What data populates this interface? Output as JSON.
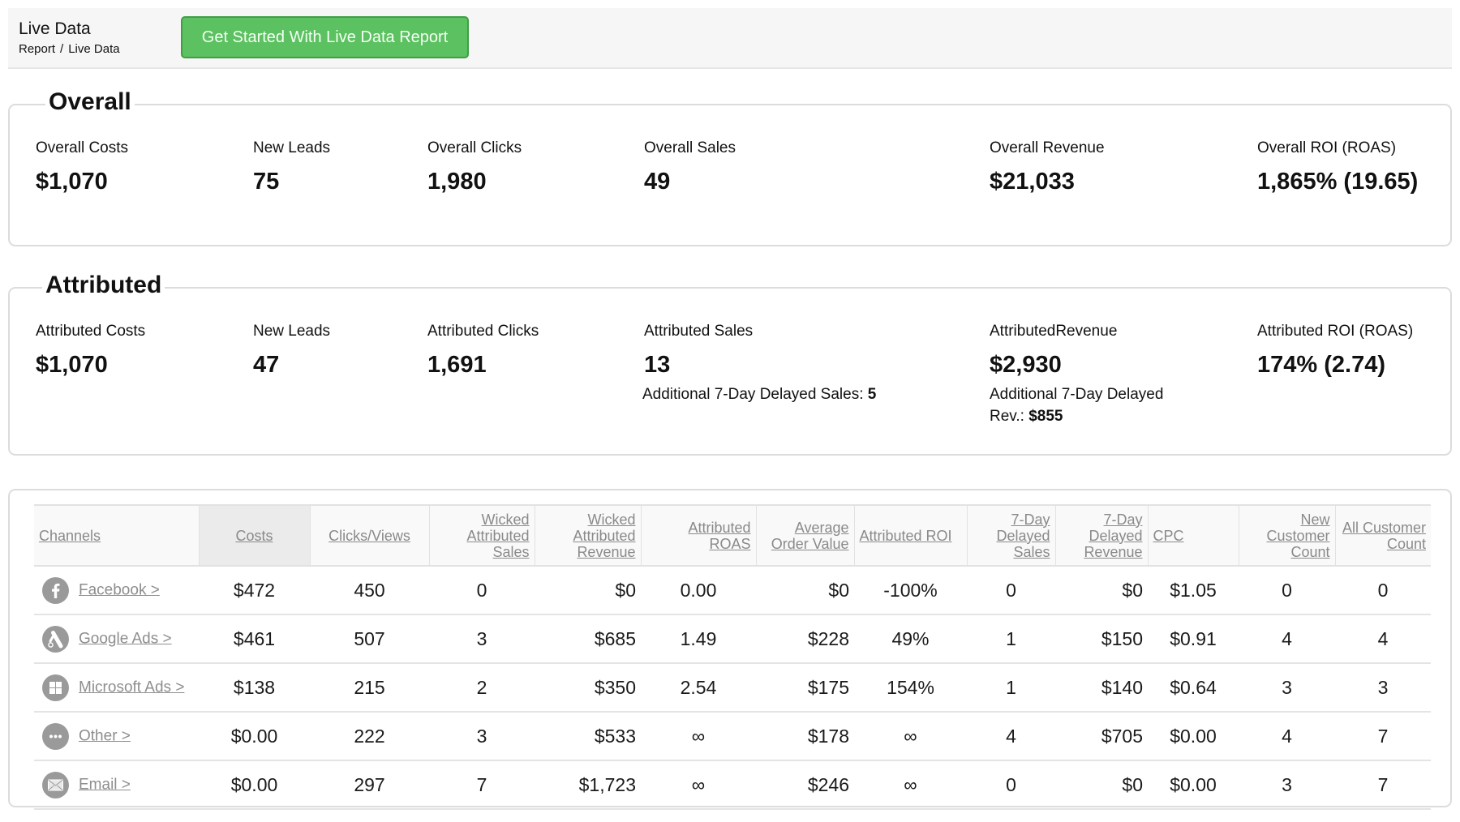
{
  "header": {
    "title": "Live Data",
    "breadcrumb": [
      "Report",
      "Live Data"
    ],
    "breadcrumb_separator": "/",
    "cta_label": "Get Started With Live Data Report",
    "cta_color": "#5cc160"
  },
  "overall": {
    "title": "Overall",
    "metrics": [
      {
        "label": "Overall Costs",
        "value": "$1,070"
      },
      {
        "label": "New Leads",
        "value": "75"
      },
      {
        "label": "Overall Clicks",
        "value": "1,980"
      },
      {
        "label": "Overall Sales",
        "value": "49"
      },
      {
        "label": "Overall Revenue",
        "value": "$21,033"
      },
      {
        "label": "Overall ROI (ROAS)",
        "value": "1,865% (19.65)"
      }
    ]
  },
  "attributed": {
    "title": "Attributed",
    "metrics": [
      {
        "label": "Attributed Costs",
        "value": "$1,070"
      },
      {
        "label": "New Leads",
        "value": "47"
      },
      {
        "label": "Attributed Clicks",
        "value": "1,691"
      },
      {
        "label": "Attributed Sales",
        "value": "13",
        "sub_label": "Additional 7-Day Delayed Sales: ",
        "sub_value": "5"
      },
      {
        "label": "AttributedRevenue",
        "value": "$2,930",
        "sub_label": "Additional 7-Day Delayed Rev.: ",
        "sub_value": "$855"
      },
      {
        "label": "Attributed ROI (ROAS)",
        "value": "174% (2.74)"
      }
    ]
  },
  "table": {
    "columns": [
      "Channels",
      "Costs",
      "Clicks/Views",
      "Wicked Attributed Sales",
      "Wicked Attributed Revenue",
      "Attributed ROAS",
      "Average Order Value",
      "Attributed ROI",
      "7-Day Delayed Sales",
      "7-Day Delayed Revenue",
      "CPC",
      "New Customer Count",
      "All Customer Count"
    ],
    "sorted_column": "Costs",
    "colors": {
      "negative": "#d9363e",
      "positive": "#5cb85c"
    },
    "rows": [
      {
        "channel": "Facebook  >",
        "icon": "facebook-icon",
        "costs": "$472",
        "clicks": "450",
        "w_sales": "0",
        "w_revenue": "$0",
        "roas": "0.00",
        "roas_tone": "neg",
        "aov": "$0",
        "roi": "-100%",
        "roi_tone": "neg",
        "d_sales": "0",
        "d_revenue": "$0",
        "cpc": "$1.05",
        "new_cust": "0",
        "all_cust": "0"
      },
      {
        "channel": "Google Ads  >",
        "icon": "google-ads-icon",
        "costs": "$461",
        "clicks": "507",
        "w_sales": "3",
        "w_revenue": "$685",
        "roas": "1.49",
        "roas_tone": "pos",
        "aov": "$228",
        "roi": "49%",
        "roi_tone": "pos",
        "d_sales": "1",
        "d_revenue": "$150",
        "cpc": "$0.91",
        "new_cust": "4",
        "all_cust": "4"
      },
      {
        "channel": "Microsoft Ads  >",
        "icon": "microsoft-icon",
        "costs": "$138",
        "clicks": "215",
        "w_sales": "2",
        "w_revenue": "$350",
        "roas": "2.54",
        "roas_tone": "pos",
        "aov": "$175",
        "roi": "154%",
        "roi_tone": "pos",
        "d_sales": "1",
        "d_revenue": "$140",
        "cpc": "$0.64",
        "new_cust": "3",
        "all_cust": "3"
      },
      {
        "channel": "Other >",
        "icon": "more-dots-icon",
        "costs": "$0.00",
        "clicks": "222",
        "w_sales": "3",
        "w_revenue": "$533",
        "roas": "∞",
        "roas_tone": "pos",
        "aov": "$178",
        "roi": "∞",
        "roi_tone": "pos",
        "d_sales": "4",
        "d_revenue": "$705",
        "cpc": "$0.00",
        "new_cust": "4",
        "all_cust": "7"
      },
      {
        "channel": "Email >",
        "icon": "email-icon",
        "costs": "$0.00",
        "clicks": "297",
        "w_sales": "7",
        "w_revenue": "$1,723",
        "roas": "∞",
        "roas_tone": "pos",
        "aov": "$246",
        "roi": "∞",
        "roi_tone": "pos",
        "d_sales": "0",
        "d_revenue": "$0",
        "cpc": "$0.00",
        "new_cust": "3",
        "all_cust": "7"
      }
    ]
  }
}
